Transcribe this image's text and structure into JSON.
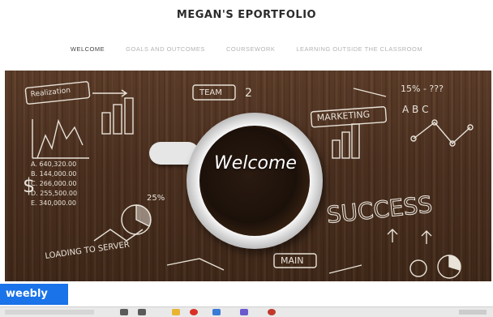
{
  "site": {
    "title": "MEGAN'S EPORTFOLIO"
  },
  "nav": {
    "items": [
      {
        "label": "WELCOME",
        "active": true
      },
      {
        "label": "GOALS AND OUTCOMES",
        "active": false
      },
      {
        "label": "COURSEWORK",
        "active": false
      },
      {
        "label": "LEARNING OUTSIDE THE CLASSROOM",
        "active": false
      }
    ]
  },
  "hero": {
    "heading": "Welcome",
    "chalk": {
      "realization": "Realization",
      "team": "TEAM",
      "marketing": "MARKETING",
      "success": "SUCCESS",
      "loading": "LOADING TO SERVER",
      "main": "MAIN",
      "percent": "15% - ???",
      "pct25": "25%",
      "abc": "A  B  C",
      "dollar": "$",
      "money_list": [
        "A. 640,320.00",
        "B. 144,000.00",
        "C. 266,000.00",
        "D. 255,500.00",
        "E. 340,000.00"
      ]
    }
  },
  "badge": {
    "label": "weebly"
  },
  "taskbar": {
    "icons": [
      {
        "name": "search-icon",
        "color": "#5a5a5a"
      },
      {
        "name": "task-view-icon",
        "color": "#5a5a5a"
      },
      {
        "name": "file-explorer-icon",
        "color": "#e8b432"
      },
      {
        "name": "chrome-icon",
        "color": "#d93025"
      },
      {
        "name": "store-icon",
        "color": "#3a7bd5"
      },
      {
        "name": "app-icon",
        "color": "#6a5acd"
      },
      {
        "name": "app-red-icon",
        "color": "#c0392b"
      }
    ]
  },
  "colors": {
    "badge": "#1a73e8",
    "nav_active": "#444444",
    "nav_inactive": "#b3b3b3"
  }
}
